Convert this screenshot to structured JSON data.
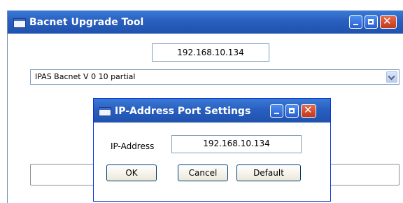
{
  "main_window": {
    "title": "Bacnet Upgrade Tool",
    "ip_value": "192.168.10.134",
    "version_selected": "IPAS Bacnet V 0 10 partial"
  },
  "dialog": {
    "title": "IP-Address Port Settings",
    "ip_label": "IP-Address",
    "ip_value": "192.168.10.134",
    "buttons": {
      "ok": "OK",
      "cancel": "Cancel",
      "default": "Default"
    }
  },
  "colors": {
    "titlebar": "#2a5fc0",
    "close_button": "#c4381b",
    "dialog_face": "#ece9d8"
  },
  "icons": [
    "app-icon",
    "minimize-icon",
    "maximize-icon",
    "close-icon",
    "chevron-down-icon"
  ]
}
